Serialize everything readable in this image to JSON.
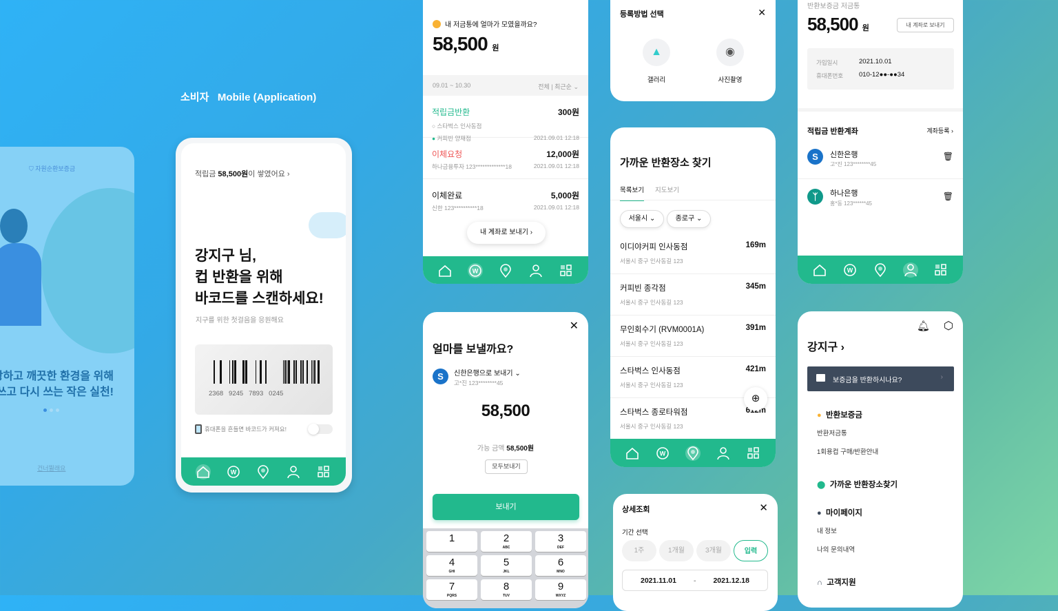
{
  "header": {
    "audience": "소비자",
    "platform": "Mobile (Application)"
  },
  "colors": {
    "accent": "#22b98d",
    "red": "#ee5555",
    "navy": "#3d4a5c"
  },
  "onboarding": {
    "logo": "자원순환보증금",
    "line1": "강하고 깨끗한 환경을 위해",
    "line2": "쓰고 다시 쓰는 작은 실천!",
    "skip": "건너뛸래요",
    "page": 1,
    "pages": 3
  },
  "home": {
    "savings_prefix": "적립금 ",
    "savings_amount": "58,500원",
    "savings_suffix": "이 쌓였어요",
    "greet1": "강지구 님,",
    "greet2": "컵 반환을 위해",
    "greet3": "바코드를 스캔하세요!",
    "sub": "지구를 위한 첫걸음을 응원해요",
    "barcode": "2368   9245   7893   0245",
    "shake": "휴대폰을 흔들면 바코드가 커져요!"
  },
  "savings": {
    "question": "내 저금통에 얼마가 모였을까요?",
    "amount": "58,500",
    "unit": "원",
    "range": "09.01 ~ 10.30",
    "filter": "전체",
    "sort": "최근순",
    "items": [
      {
        "title": "적립금반환",
        "amount": "300원",
        "from": "스타벅스 인사동점",
        "to": "커피빈 양재점",
        "date": "2021.09.01 12:18"
      },
      {
        "title": "이체요청",
        "amount": "12,000원",
        "detail": "하나금융투자 123*************18",
        "date": "2021.09.01 12:18"
      },
      {
        "title": "이체완료",
        "amount": "5,000원",
        "detail": "신한 123**********18",
        "date": "2021.09.01 12:18"
      }
    ],
    "send_btn": "내 계좌로 보내기"
  },
  "send": {
    "title": "얼마를 보낼까요?",
    "bank": "신한은행으로 보내기",
    "account": "고*진 123********45",
    "amount": "58,500",
    "avail_label": "가능 금액 ",
    "avail": "58,500원",
    "all_btn": "모두보내기",
    "submit": "보내기",
    "keys": [
      [
        "1",
        ""
      ],
      [
        "2",
        "ABC"
      ],
      [
        "3",
        "DEF"
      ],
      [
        "4",
        "GHI"
      ],
      [
        "5",
        "JKL"
      ],
      [
        "6",
        "MNO"
      ],
      [
        "7",
        "PQRS"
      ],
      [
        "8",
        "TUV"
      ],
      [
        "9",
        "WXYZ"
      ]
    ]
  },
  "register": {
    "title": "등록방법 선택",
    "gallery": "갤러리",
    "camera": "사진촬영"
  },
  "places": {
    "title": "가까운 반환장소 찾기",
    "tab_list": "목록보기",
    "tab_map": "지도보기",
    "city": "서울시",
    "district": "종로구",
    "items": [
      {
        "name": "이디야커피 인사동점",
        "dist": "169m",
        "addr": "서울시 중구 인사동길 123"
      },
      {
        "name": "커피빈 종각점",
        "dist": "345m",
        "addr": "서울시 중구 인사동길 123"
      },
      {
        "name": "무인회수기 (RVM0001A)",
        "dist": "391m",
        "addr": "서울시 중구 인사동길 123"
      },
      {
        "name": "스타벅스 인사동점",
        "dist": "421m",
        "addr": "서울시 중구 인사동길 123"
      },
      {
        "name": "스타벅스 종로타워점",
        "dist": "612m",
        "addr": "서울시 중구 인사동길 123"
      }
    ]
  },
  "detail": {
    "title": "상세조회",
    "period": "기간 선택",
    "opts": [
      "1주",
      "1개월",
      "3개월",
      "입력"
    ],
    "start": "2021.11.01",
    "sep": "-",
    "end": "2021.12.18"
  },
  "account": {
    "label": "반환보증금 저금통",
    "amount": "58,500",
    "unit": "원",
    "send_btn": "내 계좌로 보내기",
    "join_label": "가입일시",
    "join": "2021.10.01",
    "phone_label": "휴대폰번호",
    "phone": "010-12●●-●●34",
    "section": "적립금 반환계좌",
    "register": "계좌등록",
    "banks": [
      {
        "name": "신한은행",
        "acct": "고*진 123********45"
      },
      {
        "name": "하나은행",
        "acct": "홍*동 123******45"
      }
    ]
  },
  "menu": {
    "user": "강지구",
    "banner": "보증금을 반환하시나요?",
    "sections": [
      {
        "title": "반환보증금",
        "items": [
          "반환저금통",
          "1회용컵 구매/반환안내"
        ]
      },
      {
        "title": "가까운 반환장소찾기",
        "items": []
      },
      {
        "title": "마이페이지",
        "items": [
          "내 정보",
          "나의 문의내역"
        ]
      },
      {
        "title": "고객지원",
        "items": []
      }
    ]
  },
  "nav_icons": [
    "home-icon",
    "won-icon",
    "location-pin-icon",
    "user-icon",
    "grid-menu-icon"
  ]
}
